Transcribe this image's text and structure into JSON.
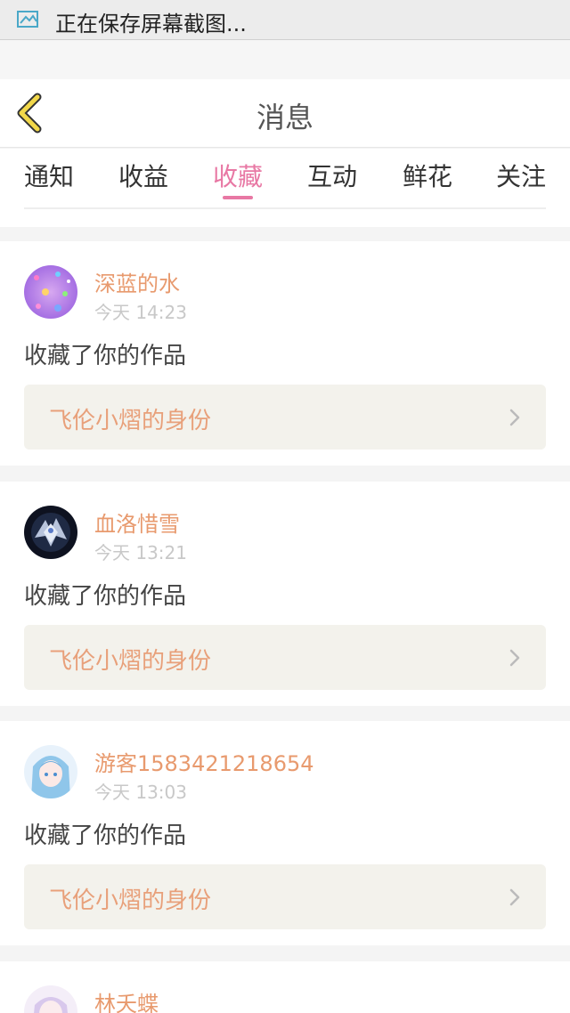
{
  "status_bar": {
    "text": "正在保存屏幕截图..."
  },
  "header": {
    "title": "消息"
  },
  "tabs": [
    {
      "label": "通知",
      "active": false
    },
    {
      "label": "收益",
      "active": false
    },
    {
      "label": "收藏",
      "active": true
    },
    {
      "label": "互动",
      "active": false
    },
    {
      "label": "鲜花",
      "active": false
    },
    {
      "label": "关注",
      "active": false
    }
  ],
  "messages": [
    {
      "username": "深蓝的水",
      "time": "今天 14:23",
      "action": "收藏了你的作品",
      "work": "飞伦小熠的身份"
    },
    {
      "username": "血洛惜雪",
      "time": "今天 13:21",
      "action": "收藏了你的作品",
      "work": "飞伦小熠的身份"
    },
    {
      "username": "游客1583421218654",
      "time": "今天 13:03",
      "action": "收藏了你的作品",
      "work": "飞伦小熠的身份"
    },
    {
      "username": "林夭蝶",
      "time": "",
      "action": "",
      "work": ""
    }
  ],
  "colors": {
    "accent": "#e878a4",
    "username": "#e89a6e",
    "work_title": "#e8a07a",
    "back_icon": "#f2d84a"
  },
  "icons": {
    "status": "screenshot-icon",
    "back": "chevron-left-icon",
    "work": "chevron-right-icon"
  }
}
